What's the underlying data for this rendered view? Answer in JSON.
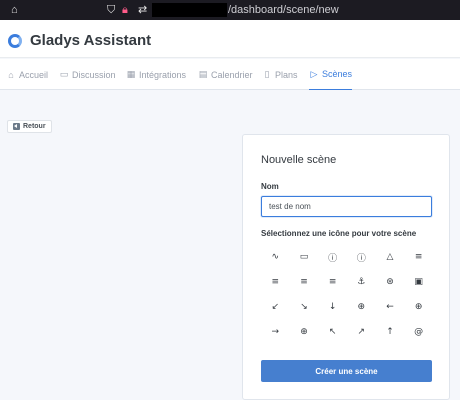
{
  "browser": {
    "url_suffix": "/dashboard/scene/new",
    "icons": [
      "home-icon",
      "shield-icon",
      "lock-icon",
      "permissions-icon"
    ]
  },
  "header": {
    "brand": "Gladys Assistant"
  },
  "nav": {
    "items": [
      {
        "label": "Accueil",
        "icon": "house-icon",
        "glyph": "⌂"
      },
      {
        "label": "Discussion",
        "icon": "chat-icon",
        "glyph": "▭"
      },
      {
        "label": "Intégrations",
        "icon": "grid-icon",
        "glyph": "▦"
      },
      {
        "label": "Calendrier",
        "icon": "calendar-icon",
        "glyph": "▤"
      },
      {
        "label": "Plans",
        "icon": "map-icon",
        "glyph": "▯"
      },
      {
        "label": "Scènes",
        "icon": "play-icon",
        "glyph": "▷"
      }
    ],
    "active": "Scènes"
  },
  "back_button": {
    "label": "Retour",
    "icon": "back-arrow-icon"
  },
  "form": {
    "title": "Nouvelle scène",
    "name_label": "Nom",
    "name_value": "test de nom",
    "icon_label": "Sélectionnez une icône pour votre scène",
    "icons": [
      {
        "name": "activity-icon",
        "glyph": "∿"
      },
      {
        "name": "airplay-icon",
        "glyph": "▭"
      },
      {
        "name": "alert-circle-icon",
        "glyph": "ⓘ"
      },
      {
        "name": "alert-octagon-icon",
        "glyph": "ⓘ"
      },
      {
        "name": "alert-triangle-icon",
        "glyph": "△"
      },
      {
        "name": "align-center-icon",
        "glyph": "≡"
      },
      {
        "name": "align-justify-icon",
        "glyph": "≡"
      },
      {
        "name": "align-left-icon",
        "glyph": "≡"
      },
      {
        "name": "align-right-icon",
        "glyph": "≡"
      },
      {
        "name": "anchor-icon",
        "glyph": "⚓"
      },
      {
        "name": "aperture-icon",
        "glyph": "⊛"
      },
      {
        "name": "archive-icon",
        "glyph": "▣"
      },
      {
        "name": "arrow-down-left-icon",
        "glyph": "↙"
      },
      {
        "name": "arrow-down-right-icon",
        "glyph": "↘"
      },
      {
        "name": "arrow-down-icon",
        "glyph": "↓"
      },
      {
        "name": "arrow-down-circle-icon",
        "glyph": "⊕"
      },
      {
        "name": "arrow-left-icon",
        "glyph": "←"
      },
      {
        "name": "arrow-left-circle-icon",
        "glyph": "⊕"
      },
      {
        "name": "arrow-right-icon",
        "glyph": "→"
      },
      {
        "name": "arrow-up-circle-icon",
        "glyph": "⊕"
      },
      {
        "name": "arrow-up-left-icon",
        "glyph": "↖"
      },
      {
        "name": "arrow-up-right-icon",
        "glyph": "↗"
      },
      {
        "name": "arrow-up-icon",
        "glyph": "↑"
      },
      {
        "name": "at-sign-icon",
        "glyph": "@"
      }
    ],
    "submit_label": "Créer une scène"
  }
}
